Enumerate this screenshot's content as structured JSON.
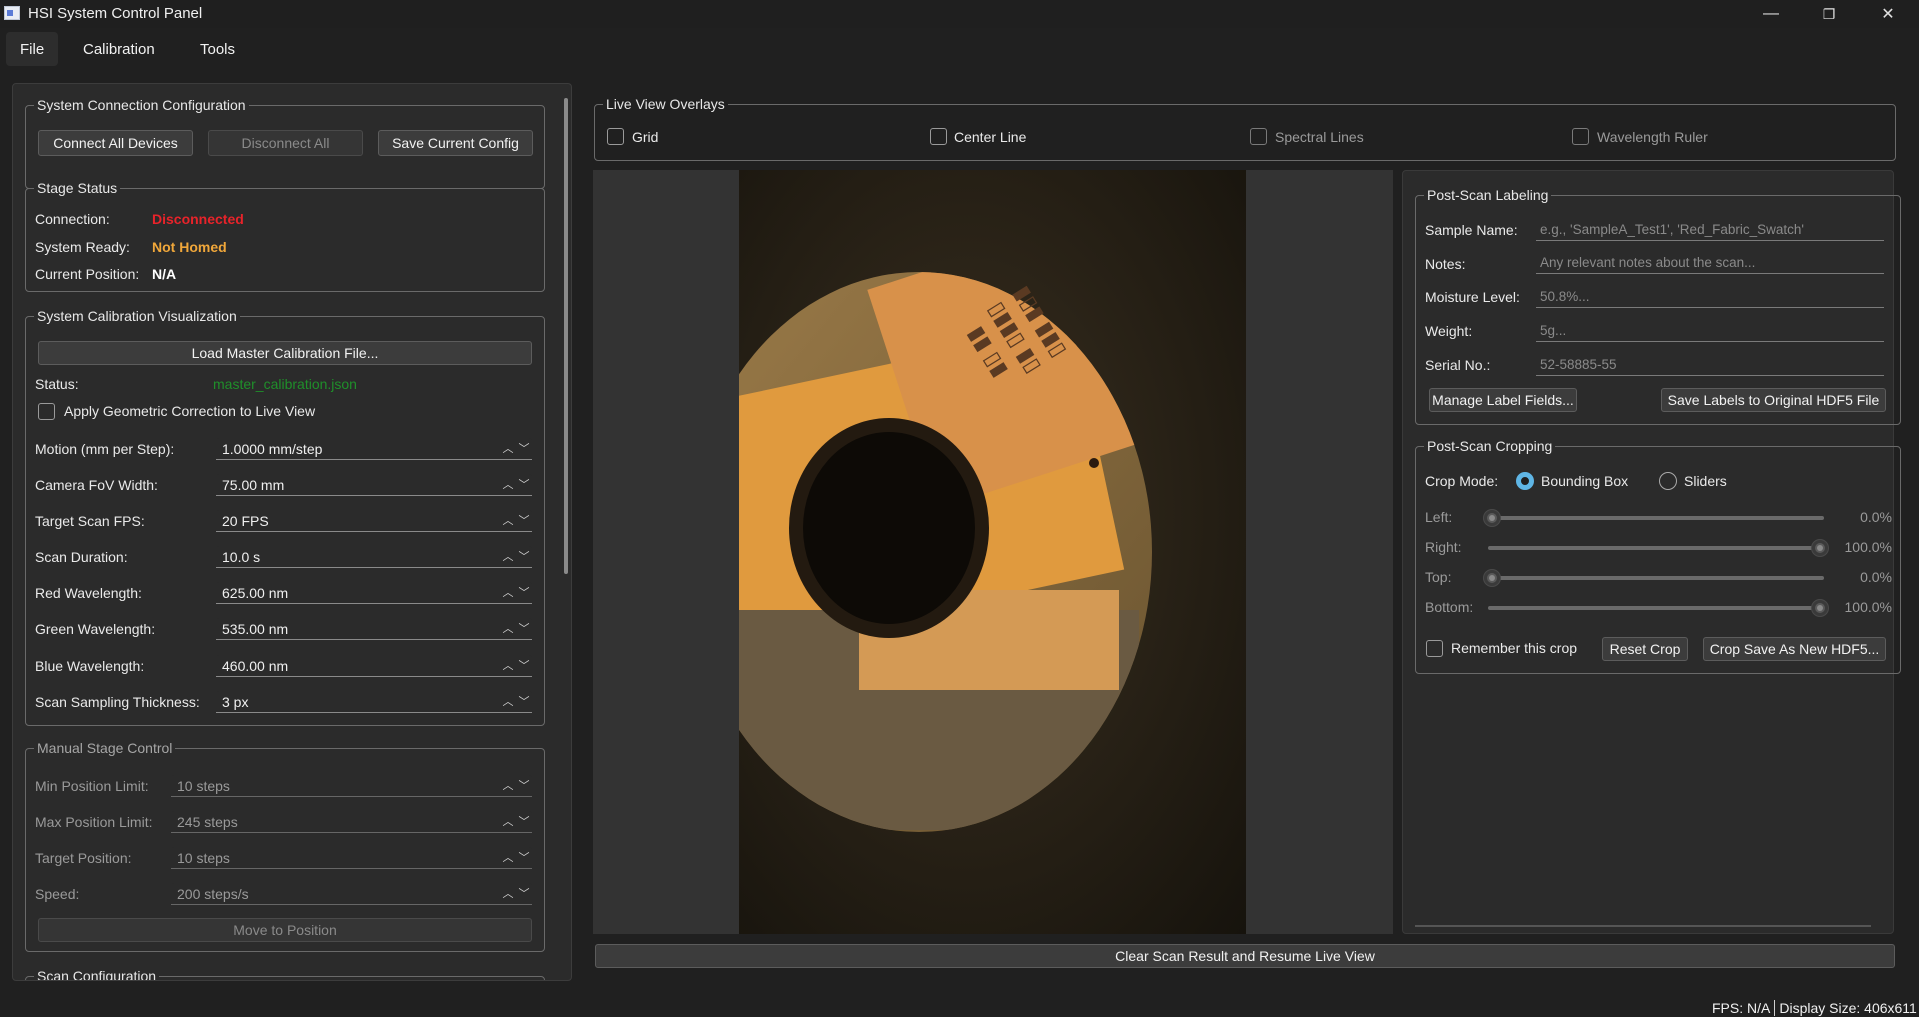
{
  "window": {
    "title": "HSI System Control Panel",
    "minimize_glyph": "—",
    "maximize_glyph": "❐",
    "close_glyph": "✕"
  },
  "menu": {
    "items": [
      "File",
      "Calibration",
      "Tools"
    ]
  },
  "connection": {
    "title": "System Connection  Configuration",
    "connect_all": "Connect All Devices",
    "disconnect_all": "Disconnect All",
    "save_config": "Save Current Config"
  },
  "stage_status": {
    "title": "Stage Status",
    "connection_label": "Connection:",
    "connection_value": "Disconnected",
    "ready_label": "System Ready:",
    "ready_value": "Not Homed",
    "position_label": "Current Position:",
    "position_value": "N/A"
  },
  "calibration": {
    "title": "System Calibration  Visualization",
    "load_button": "Load Master Calibration File...",
    "status_label": "Status:",
    "status_value": "master_calibration.json",
    "geometric_correction": "Apply Geometric Correction to Live View",
    "fields": [
      {
        "label": "Motion (mm per Step):",
        "value": "1.0000 mm/step"
      },
      {
        "label": "Camera FoV Width:",
        "value": "75.00 mm"
      },
      {
        "label": "Target Scan FPS:",
        "value": "20 FPS"
      },
      {
        "label": "Scan Duration:",
        "value": "10.0 s"
      },
      {
        "label": "Red Wavelength:",
        "value": "625.00 nm"
      },
      {
        "label": "Green Wavelength:",
        "value": "535.00 nm"
      },
      {
        "label": "Blue Wavelength:",
        "value": "460.00 nm"
      },
      {
        "label": "Scan Sampling Thickness:",
        "value": "3 px"
      }
    ]
  },
  "manual_stage": {
    "title": "Manual Stage Control",
    "fields": [
      {
        "label": "Min Position Limit:",
        "value": "10 steps"
      },
      {
        "label": "Max Position Limit:",
        "value": "245 steps"
      },
      {
        "label": "Target Position:",
        "value": "10 steps"
      },
      {
        "label": "Speed:",
        "value": "200 steps/s"
      }
    ],
    "move_button": "Move to Position"
  },
  "scan_config": {
    "title": "Scan Configuration"
  },
  "overlays": {
    "title": "Live View Overlays",
    "grid": "Grid",
    "center_line": "Center Line",
    "spectral_lines": "Spectral Lines",
    "wavelength_ruler": "Wavelength Ruler"
  },
  "labeling": {
    "title": "Post-Scan Labeling",
    "sample_name_label": "Sample Name:",
    "sample_name_placeholder": "e.g., 'SampleA_Test1', 'Red_Fabric_Swatch'",
    "notes_label": "Notes:",
    "notes_placeholder": "Any relevant notes about the scan...",
    "moisture_label": "Moisture Level:",
    "moisture_placeholder": "50.8%...",
    "weight_label": "Weight:",
    "weight_placeholder": "5g...",
    "serial_label": "Serial No.:",
    "serial_placeholder": "52-58885-55",
    "manage_button": "Manage Label Fields...",
    "save_button": "Save Labels to Original HDF5 File"
  },
  "cropping": {
    "title": "Post-Scan Cropping",
    "mode_label": "Crop Mode:",
    "mode_bbox": "Bounding Box",
    "mode_sliders": "Sliders",
    "selected_mode": "Bounding Box",
    "sliders": [
      {
        "label": "Left:",
        "value": "0.0%",
        "fraction": 0.0
      },
      {
        "label": "Right:",
        "value": "100.0%",
        "fraction": 1.0
      },
      {
        "label": "Top:",
        "value": "0.0%",
        "fraction": 0.0
      },
      {
        "label": "Bottom:",
        "value": "100.0%",
        "fraction": 1.0
      }
    ],
    "remember": "Remember this crop",
    "reset_button": "Reset Crop",
    "save_button": "Crop  Save As New HDF5..."
  },
  "clear_button": "Clear Scan Result and Resume Live View",
  "statusbar": {
    "fps": "FPS: N/A",
    "display_size": "Display Size: 406x611"
  },
  "colors": {
    "error": "#e8232a",
    "warning": "#f0a73a",
    "ok": "#1f8f2a",
    "accent": "#5fb6e6"
  }
}
